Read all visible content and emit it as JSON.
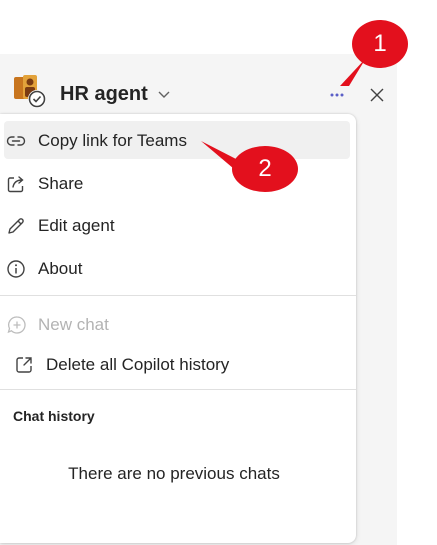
{
  "header": {
    "agent_name": "HR agent",
    "avatar_icon": "hr-agent-avatar-icon",
    "more_icon": "more-horizontal-icon",
    "close_icon": "close-icon",
    "chevron_icon": "chevron-down-icon"
  },
  "menu": {
    "items": [
      {
        "label": "Copy link for Teams",
        "icon": "link-icon"
      },
      {
        "label": "Share",
        "icon": "share-icon"
      },
      {
        "label": "Edit agent",
        "icon": "pencil-icon"
      },
      {
        "label": "About",
        "icon": "info-icon"
      },
      {
        "label": "New chat",
        "icon": "new-chat-icon",
        "disabled": true
      },
      {
        "label": "Delete all Copilot history",
        "icon": "external-link-icon"
      }
    ],
    "chat_history_title": "Chat history",
    "empty_message": "There are no previous chats"
  },
  "callouts": [
    "1",
    "2"
  ],
  "colors": {
    "callout": "#e3101d",
    "accent": "#5b5fc7",
    "pane_bg": "#f5f5f5"
  }
}
